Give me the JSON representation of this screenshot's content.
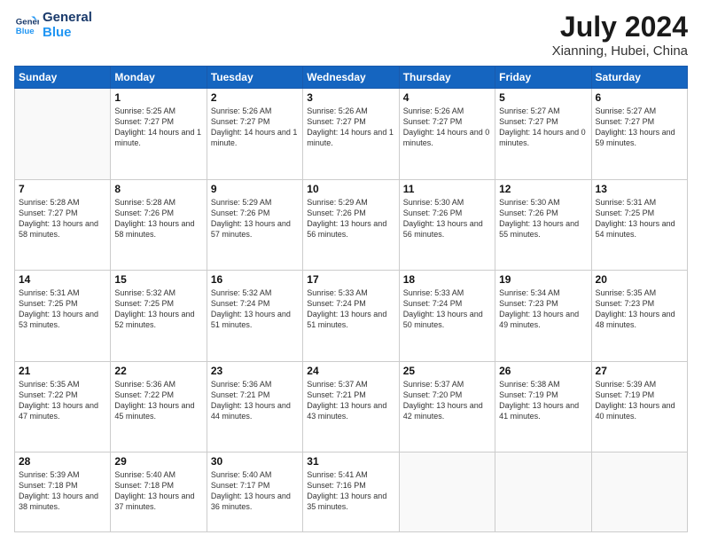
{
  "header": {
    "logo_line1": "General",
    "logo_line2": "Blue",
    "title": "July 2024",
    "subtitle": "Xianning, Hubei, China"
  },
  "weekdays": [
    "Sunday",
    "Monday",
    "Tuesday",
    "Wednesday",
    "Thursday",
    "Friday",
    "Saturday"
  ],
  "weeks": [
    [
      {
        "day": "",
        "sunrise": "",
        "sunset": "",
        "daylight": ""
      },
      {
        "day": "1",
        "sunrise": "5:25 AM",
        "sunset": "7:27 PM",
        "daylight": "14 hours and 1 minute."
      },
      {
        "day": "2",
        "sunrise": "5:26 AM",
        "sunset": "7:27 PM",
        "daylight": "14 hours and 1 minute."
      },
      {
        "day": "3",
        "sunrise": "5:26 AM",
        "sunset": "7:27 PM",
        "daylight": "14 hours and 1 minute."
      },
      {
        "day": "4",
        "sunrise": "5:26 AM",
        "sunset": "7:27 PM",
        "daylight": "14 hours and 0 minutes."
      },
      {
        "day": "5",
        "sunrise": "5:27 AM",
        "sunset": "7:27 PM",
        "daylight": "14 hours and 0 minutes."
      },
      {
        "day": "6",
        "sunrise": "5:27 AM",
        "sunset": "7:27 PM",
        "daylight": "13 hours and 59 minutes."
      }
    ],
    [
      {
        "day": "7",
        "sunrise": "5:28 AM",
        "sunset": "7:27 PM",
        "daylight": "13 hours and 58 minutes."
      },
      {
        "day": "8",
        "sunrise": "5:28 AM",
        "sunset": "7:26 PM",
        "daylight": "13 hours and 58 minutes."
      },
      {
        "day": "9",
        "sunrise": "5:29 AM",
        "sunset": "7:26 PM",
        "daylight": "13 hours and 57 minutes."
      },
      {
        "day": "10",
        "sunrise": "5:29 AM",
        "sunset": "7:26 PM",
        "daylight": "13 hours and 56 minutes."
      },
      {
        "day": "11",
        "sunrise": "5:30 AM",
        "sunset": "7:26 PM",
        "daylight": "13 hours and 56 minutes."
      },
      {
        "day": "12",
        "sunrise": "5:30 AM",
        "sunset": "7:26 PM",
        "daylight": "13 hours and 55 minutes."
      },
      {
        "day": "13",
        "sunrise": "5:31 AM",
        "sunset": "7:25 PM",
        "daylight": "13 hours and 54 minutes."
      }
    ],
    [
      {
        "day": "14",
        "sunrise": "5:31 AM",
        "sunset": "7:25 PM",
        "daylight": "13 hours and 53 minutes."
      },
      {
        "day": "15",
        "sunrise": "5:32 AM",
        "sunset": "7:25 PM",
        "daylight": "13 hours and 52 minutes."
      },
      {
        "day": "16",
        "sunrise": "5:32 AM",
        "sunset": "7:24 PM",
        "daylight": "13 hours and 51 minutes."
      },
      {
        "day": "17",
        "sunrise": "5:33 AM",
        "sunset": "7:24 PM",
        "daylight": "13 hours and 51 minutes."
      },
      {
        "day": "18",
        "sunrise": "5:33 AM",
        "sunset": "7:24 PM",
        "daylight": "13 hours and 50 minutes."
      },
      {
        "day": "19",
        "sunrise": "5:34 AM",
        "sunset": "7:23 PM",
        "daylight": "13 hours and 49 minutes."
      },
      {
        "day": "20",
        "sunrise": "5:35 AM",
        "sunset": "7:23 PM",
        "daylight": "13 hours and 48 minutes."
      }
    ],
    [
      {
        "day": "21",
        "sunrise": "5:35 AM",
        "sunset": "7:22 PM",
        "daylight": "13 hours and 47 minutes."
      },
      {
        "day": "22",
        "sunrise": "5:36 AM",
        "sunset": "7:22 PM",
        "daylight": "13 hours and 45 minutes."
      },
      {
        "day": "23",
        "sunrise": "5:36 AM",
        "sunset": "7:21 PM",
        "daylight": "13 hours and 44 minutes."
      },
      {
        "day": "24",
        "sunrise": "5:37 AM",
        "sunset": "7:21 PM",
        "daylight": "13 hours and 43 minutes."
      },
      {
        "day": "25",
        "sunrise": "5:37 AM",
        "sunset": "7:20 PM",
        "daylight": "13 hours and 42 minutes."
      },
      {
        "day": "26",
        "sunrise": "5:38 AM",
        "sunset": "7:19 PM",
        "daylight": "13 hours and 41 minutes."
      },
      {
        "day": "27",
        "sunrise": "5:39 AM",
        "sunset": "7:19 PM",
        "daylight": "13 hours and 40 minutes."
      }
    ],
    [
      {
        "day": "28",
        "sunrise": "5:39 AM",
        "sunset": "7:18 PM",
        "daylight": "13 hours and 38 minutes."
      },
      {
        "day": "29",
        "sunrise": "5:40 AM",
        "sunset": "7:18 PM",
        "daylight": "13 hours and 37 minutes."
      },
      {
        "day": "30",
        "sunrise": "5:40 AM",
        "sunset": "7:17 PM",
        "daylight": "13 hours and 36 minutes."
      },
      {
        "day": "31",
        "sunrise": "5:41 AM",
        "sunset": "7:16 PM",
        "daylight": "13 hours and 35 minutes."
      },
      {
        "day": "",
        "sunrise": "",
        "sunset": "",
        "daylight": ""
      },
      {
        "day": "",
        "sunrise": "",
        "sunset": "",
        "daylight": ""
      },
      {
        "day": "",
        "sunrise": "",
        "sunset": "",
        "daylight": ""
      }
    ]
  ]
}
